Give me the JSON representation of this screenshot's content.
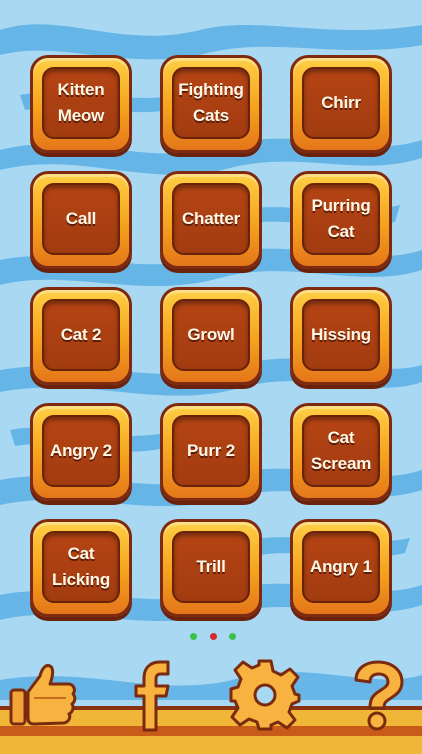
{
  "sounds": [
    {
      "label": "Kitten\nMeow"
    },
    {
      "label": "Fighting\nCats"
    },
    {
      "label": "Chirr"
    },
    {
      "label": "Call"
    },
    {
      "label": "Chatter"
    },
    {
      "label": "Purring\nCat"
    },
    {
      "label": "Cat 2"
    },
    {
      "label": "Growl"
    },
    {
      "label": "Hissing"
    },
    {
      "label": "Angry 2"
    },
    {
      "label": "Purr 2"
    },
    {
      "label": "Cat\nScream"
    },
    {
      "label": "Cat\nLicking"
    },
    {
      "label": "Trill"
    },
    {
      "label": "Angry 1"
    }
  ],
  "pager": {
    "dots": [
      "#3cc24a",
      "#d8292c",
      "#3cc24a"
    ]
  },
  "bottom_bar": {
    "like_icon": "thumbs-up-icon",
    "facebook_icon": "facebook-icon",
    "facebook_letter": "f",
    "settings_icon": "gear-icon",
    "help_icon": "question-mark-icon",
    "help_glyph": "?"
  },
  "colors": {
    "button_outer": "#f5a21e",
    "button_inner": "#a23c10",
    "background": "#a9d8f3"
  }
}
